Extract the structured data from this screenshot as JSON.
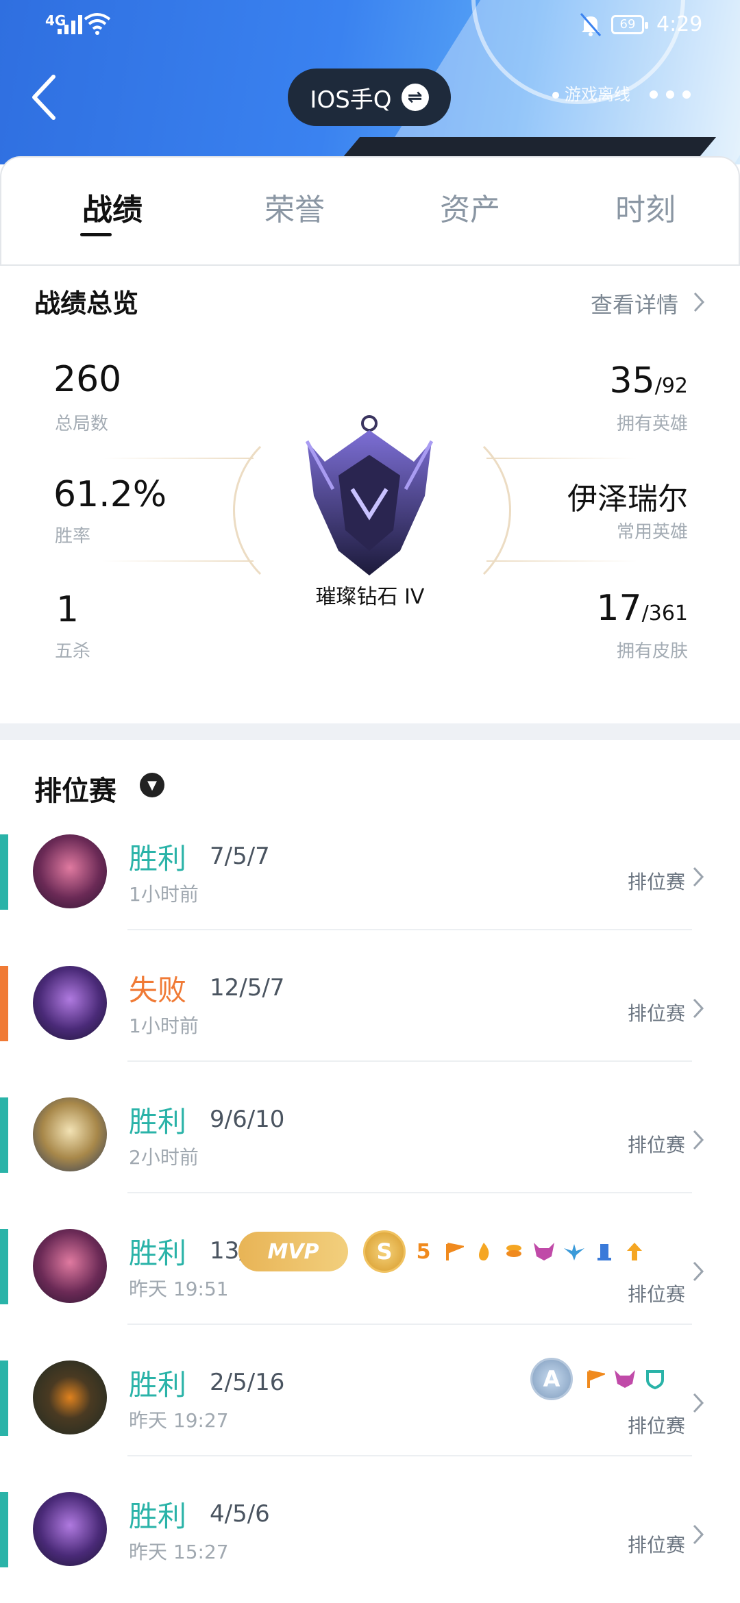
{
  "status": {
    "network": "4G",
    "battery": "69",
    "time": "4:29"
  },
  "header": {
    "switch_label": "IOS手Q",
    "switch_icon": "⇌",
    "offline_label": "游戏离线"
  },
  "tabs": [
    "战绩",
    "荣誉",
    "资产",
    "时刻"
  ],
  "overview": {
    "title": "战绩总览",
    "detail_link": "查看详情",
    "total_games": "260",
    "total_games_label": "总局数",
    "win_rate": "61.2%",
    "win_rate_label": "胜率",
    "penta": "1",
    "penta_label": "五杀",
    "heroes_owned": "35",
    "heroes_total": "/92",
    "heroes_label": "拥有英雄",
    "common_hero": "伊泽瑞尔",
    "common_hero_label": "常用英雄",
    "skins_owned": "17",
    "skins_total": "/361",
    "skins_label": "拥有皮肤",
    "rank": "璀璨钻石 IV"
  },
  "matches_section": {
    "title": "排位赛",
    "dropdown_icon": "chevron-down-icon"
  },
  "colors": {
    "win": "#2ab3a8",
    "loss": "#f07a35"
  },
  "badge_text": {
    "mvp": "MVP",
    "s": "S",
    "a": "A",
    "five": "5"
  },
  "matches": [
    {
      "result": "胜利",
      "kda": "7/5/7",
      "time": "1小时前",
      "mode": "排位赛",
      "outcome": "win"
    },
    {
      "result": "失败",
      "kda": "12/5/7",
      "time": "1小时前",
      "mode": "排位赛",
      "outcome": "loss"
    },
    {
      "result": "胜利",
      "kda": "9/6/10",
      "time": "2小时前",
      "mode": "排位赛",
      "outcome": "win"
    },
    {
      "result": "胜利",
      "kda": "13/",
      "time": "昨天 19:51",
      "mode": "排位赛",
      "outcome": "win"
    },
    {
      "result": "胜利",
      "kda": "2/5/16",
      "time": "昨天 19:27",
      "mode": "排位赛",
      "outcome": "win"
    },
    {
      "result": "胜利",
      "kda": "4/5/6",
      "time": "昨天 15:27",
      "mode": "排位赛",
      "outcome": "win"
    }
  ]
}
